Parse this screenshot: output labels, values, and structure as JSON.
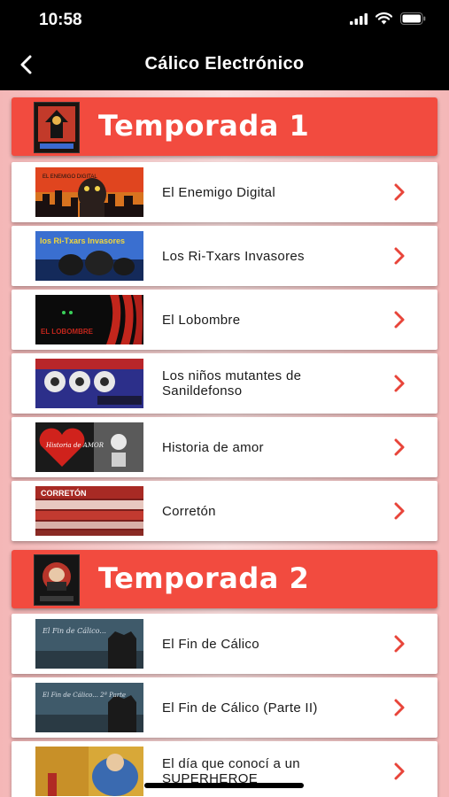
{
  "status": {
    "time": "10:58"
  },
  "nav": {
    "title": "Cálico Electrónico"
  },
  "colors": {
    "accent": "#f24b3f",
    "chevron": "#e8453a"
  },
  "seasons": [
    {
      "title": "Temporada 1",
      "episodes": [
        {
          "title": "El Enemigo Digital",
          "thumb_text": "EL ENEMIGO DIGITAL"
        },
        {
          "title": "Los Ri-Txars Invasores",
          "thumb_text": "los Ri-Txars Invasores"
        },
        {
          "title": "El Lobombre",
          "thumb_text": "EL LOBOMBRE"
        },
        {
          "title": "Los niños mutantes de Sanildefonso",
          "thumb_text": ""
        },
        {
          "title": "Historia de amor",
          "thumb_text": "Historia de AMOR"
        },
        {
          "title": "Corretón",
          "thumb_text": "CORRETÓN"
        }
      ]
    },
    {
      "title": "Temporada 2",
      "episodes": [
        {
          "title": "El Fin de Cálico",
          "thumb_text": "El Fin de Cálico..."
        },
        {
          "title": "El Fin de Cálico (Parte II)",
          "thumb_text": "El Fin de Cálico... 2ª Parte"
        },
        {
          "title": "El día que conocí a un SUPERHEROE",
          "thumb_text": ""
        }
      ]
    }
  ]
}
